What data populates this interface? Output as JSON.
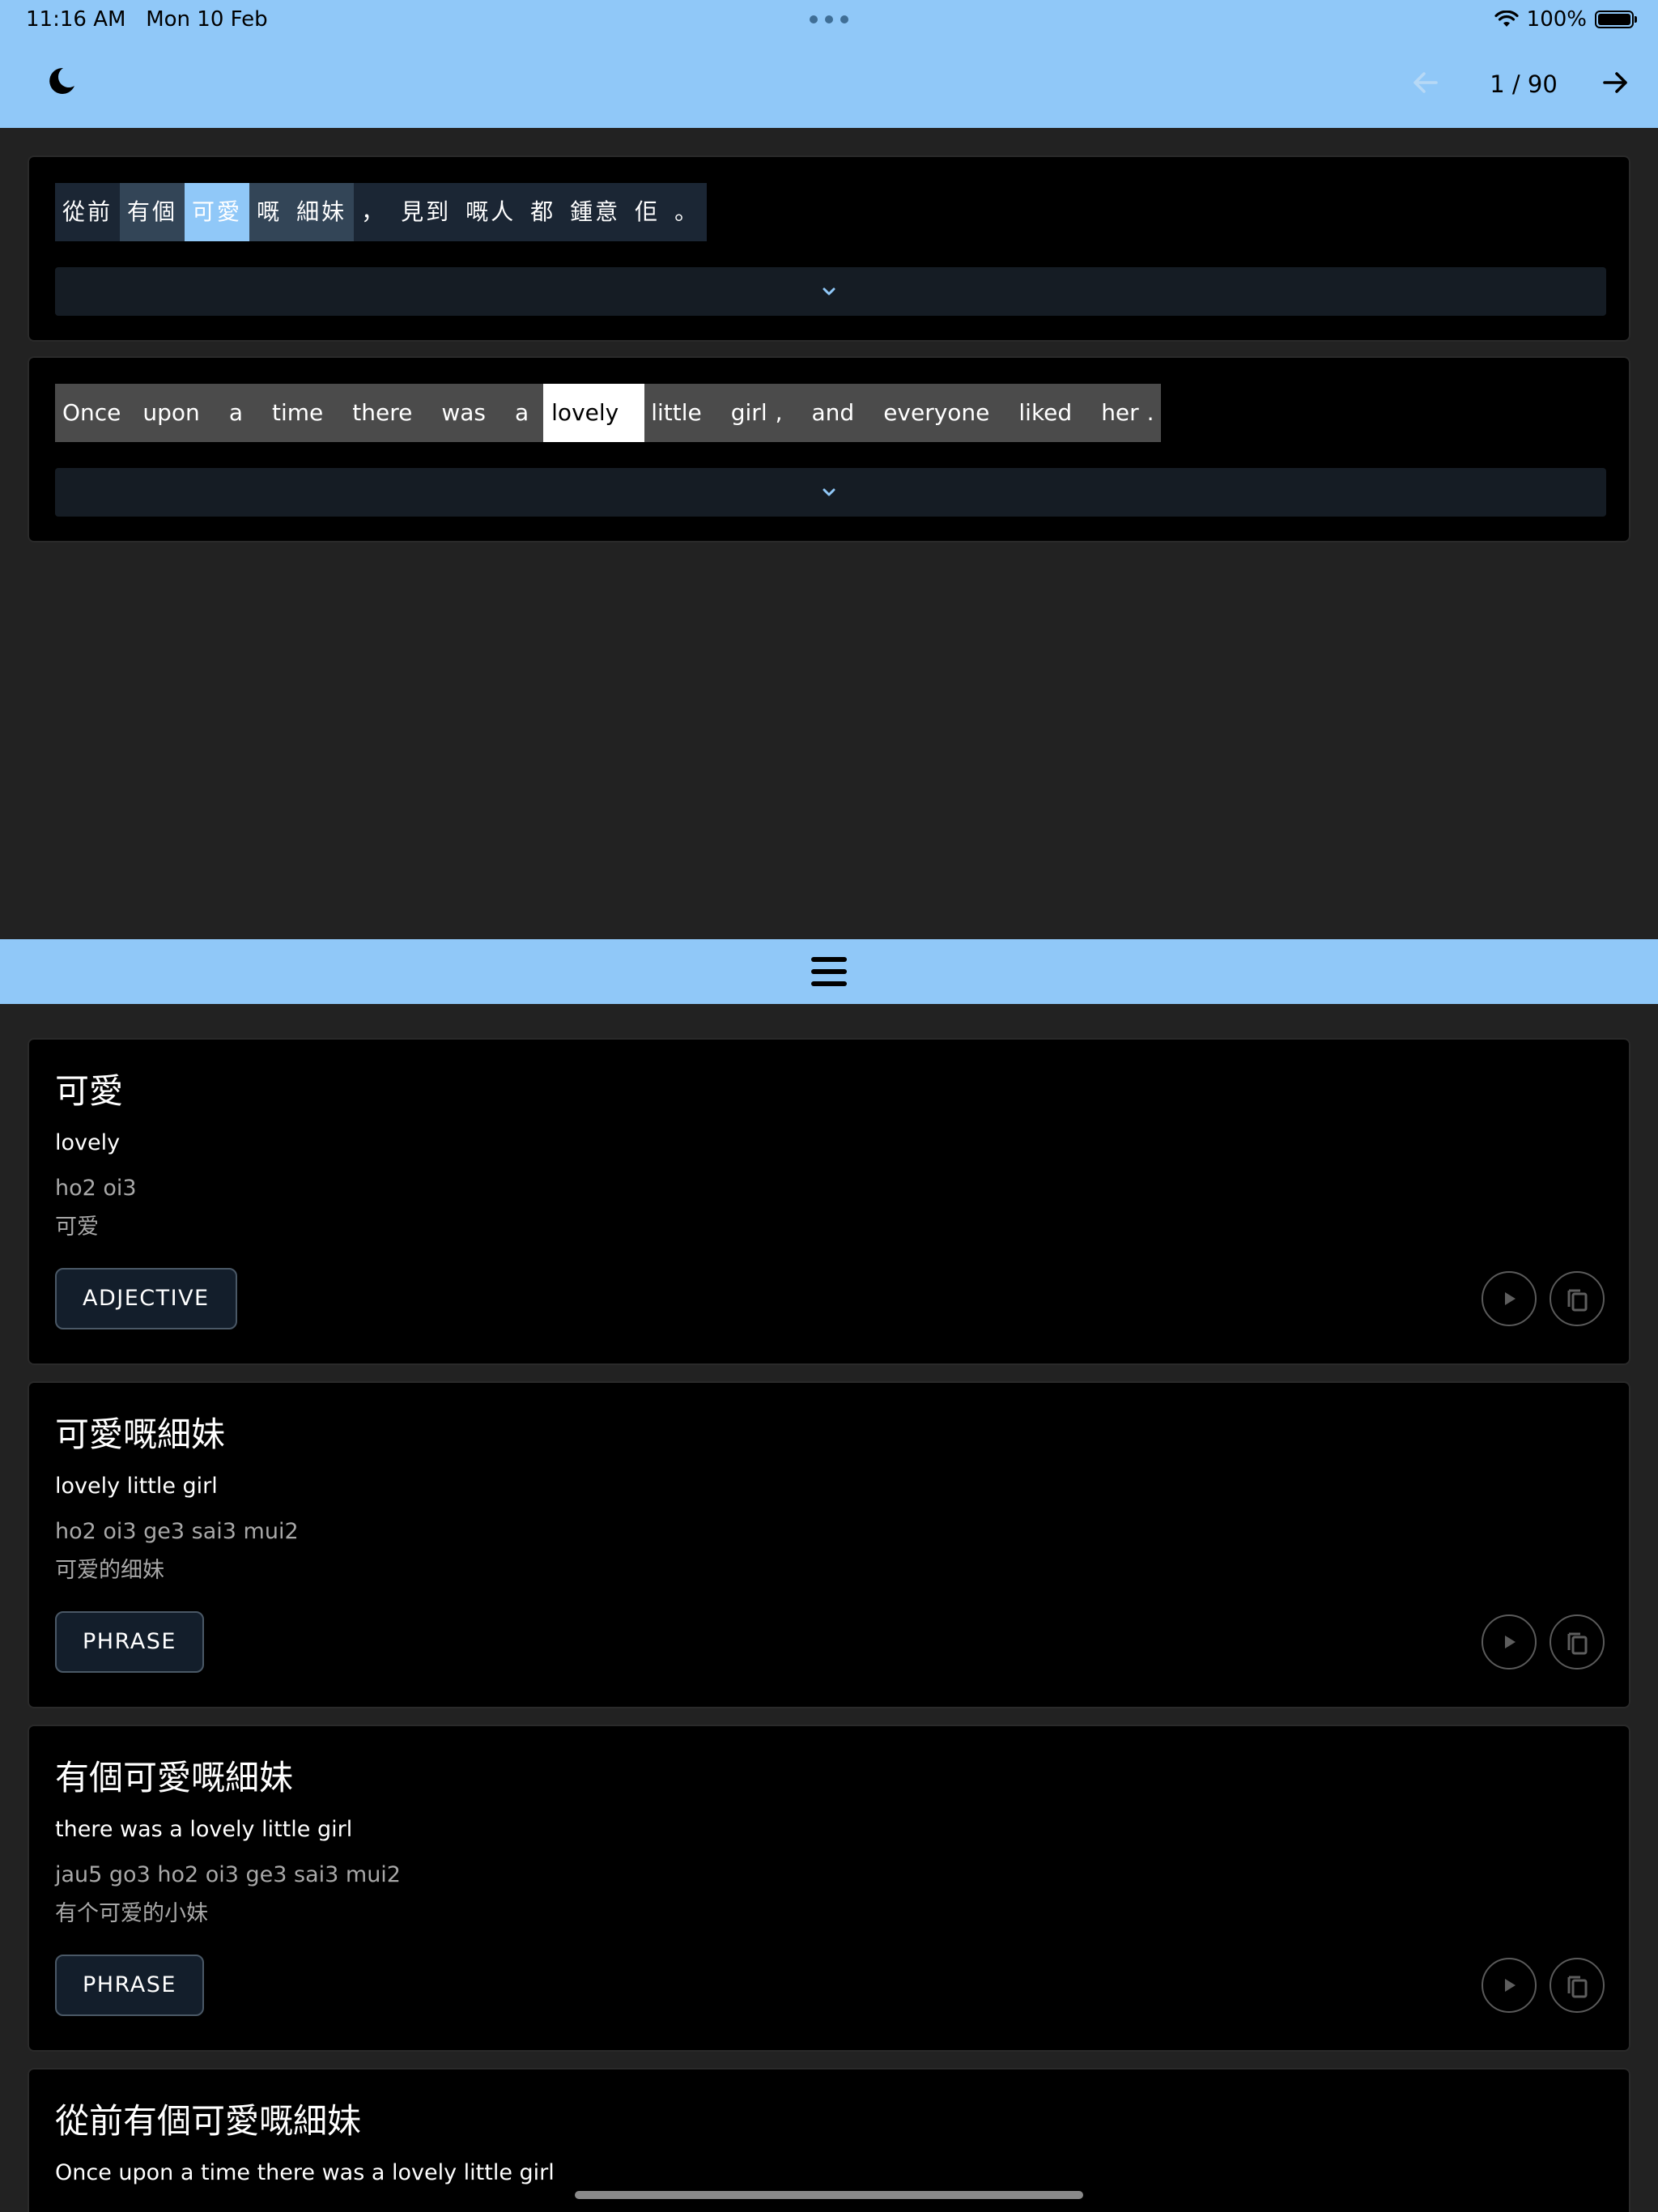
{
  "status": {
    "time": "11:16 AM",
    "date": "Mon 10 Feb",
    "battery": "100%"
  },
  "toolbar": {
    "page_counter": "1 / 90"
  },
  "sentences": {
    "chinese_tokens": [
      "從前",
      "有個",
      "可愛",
      "嘅",
      "細妹",
      "，",
      "見到",
      "嘅人",
      "都",
      "鍾意",
      "佢",
      "。"
    ],
    "english_tokens": [
      "Once",
      "upon",
      "a",
      "time",
      "there",
      "was",
      "a",
      "lovely",
      "little",
      "girl",
      ",",
      "and",
      "everyone",
      "liked",
      "her",
      "."
    ]
  },
  "dictionary": [
    {
      "headword": "可愛",
      "definition": "lovely",
      "jyutping": "ho2 oi3",
      "simplified": "可爱",
      "pos": "ADJECTIVE"
    },
    {
      "headword": "可愛嘅細妹",
      "definition": "lovely little girl",
      "jyutping": "ho2 oi3 ge3 sai3 mui2",
      "simplified": "可爱的细妹",
      "pos": "PHRASE"
    },
    {
      "headword": "有個可愛嘅細妹",
      "definition": "there was a lovely little girl",
      "jyutping": "jau5 go3 ho2 oi3 ge3 sai3 mui2",
      "simplified": "有个可爱的小妹",
      "pos": "PHRASE"
    },
    {
      "headword": "從前有個可愛嘅細妹",
      "definition": "Once upon a time there was a lovely little girl"
    }
  ],
  "colors": {
    "accent": "#90c8f8",
    "background": "#222222",
    "card": "#000000"
  },
  "icons": {
    "theme_toggle": "moon-icon",
    "prev": "arrow-left-icon",
    "next": "arrow-right-icon",
    "expand": "chevron-down-icon",
    "drawer_handle": "hamburger-icon",
    "play": "play-icon",
    "copy": "copy-icon"
  }
}
